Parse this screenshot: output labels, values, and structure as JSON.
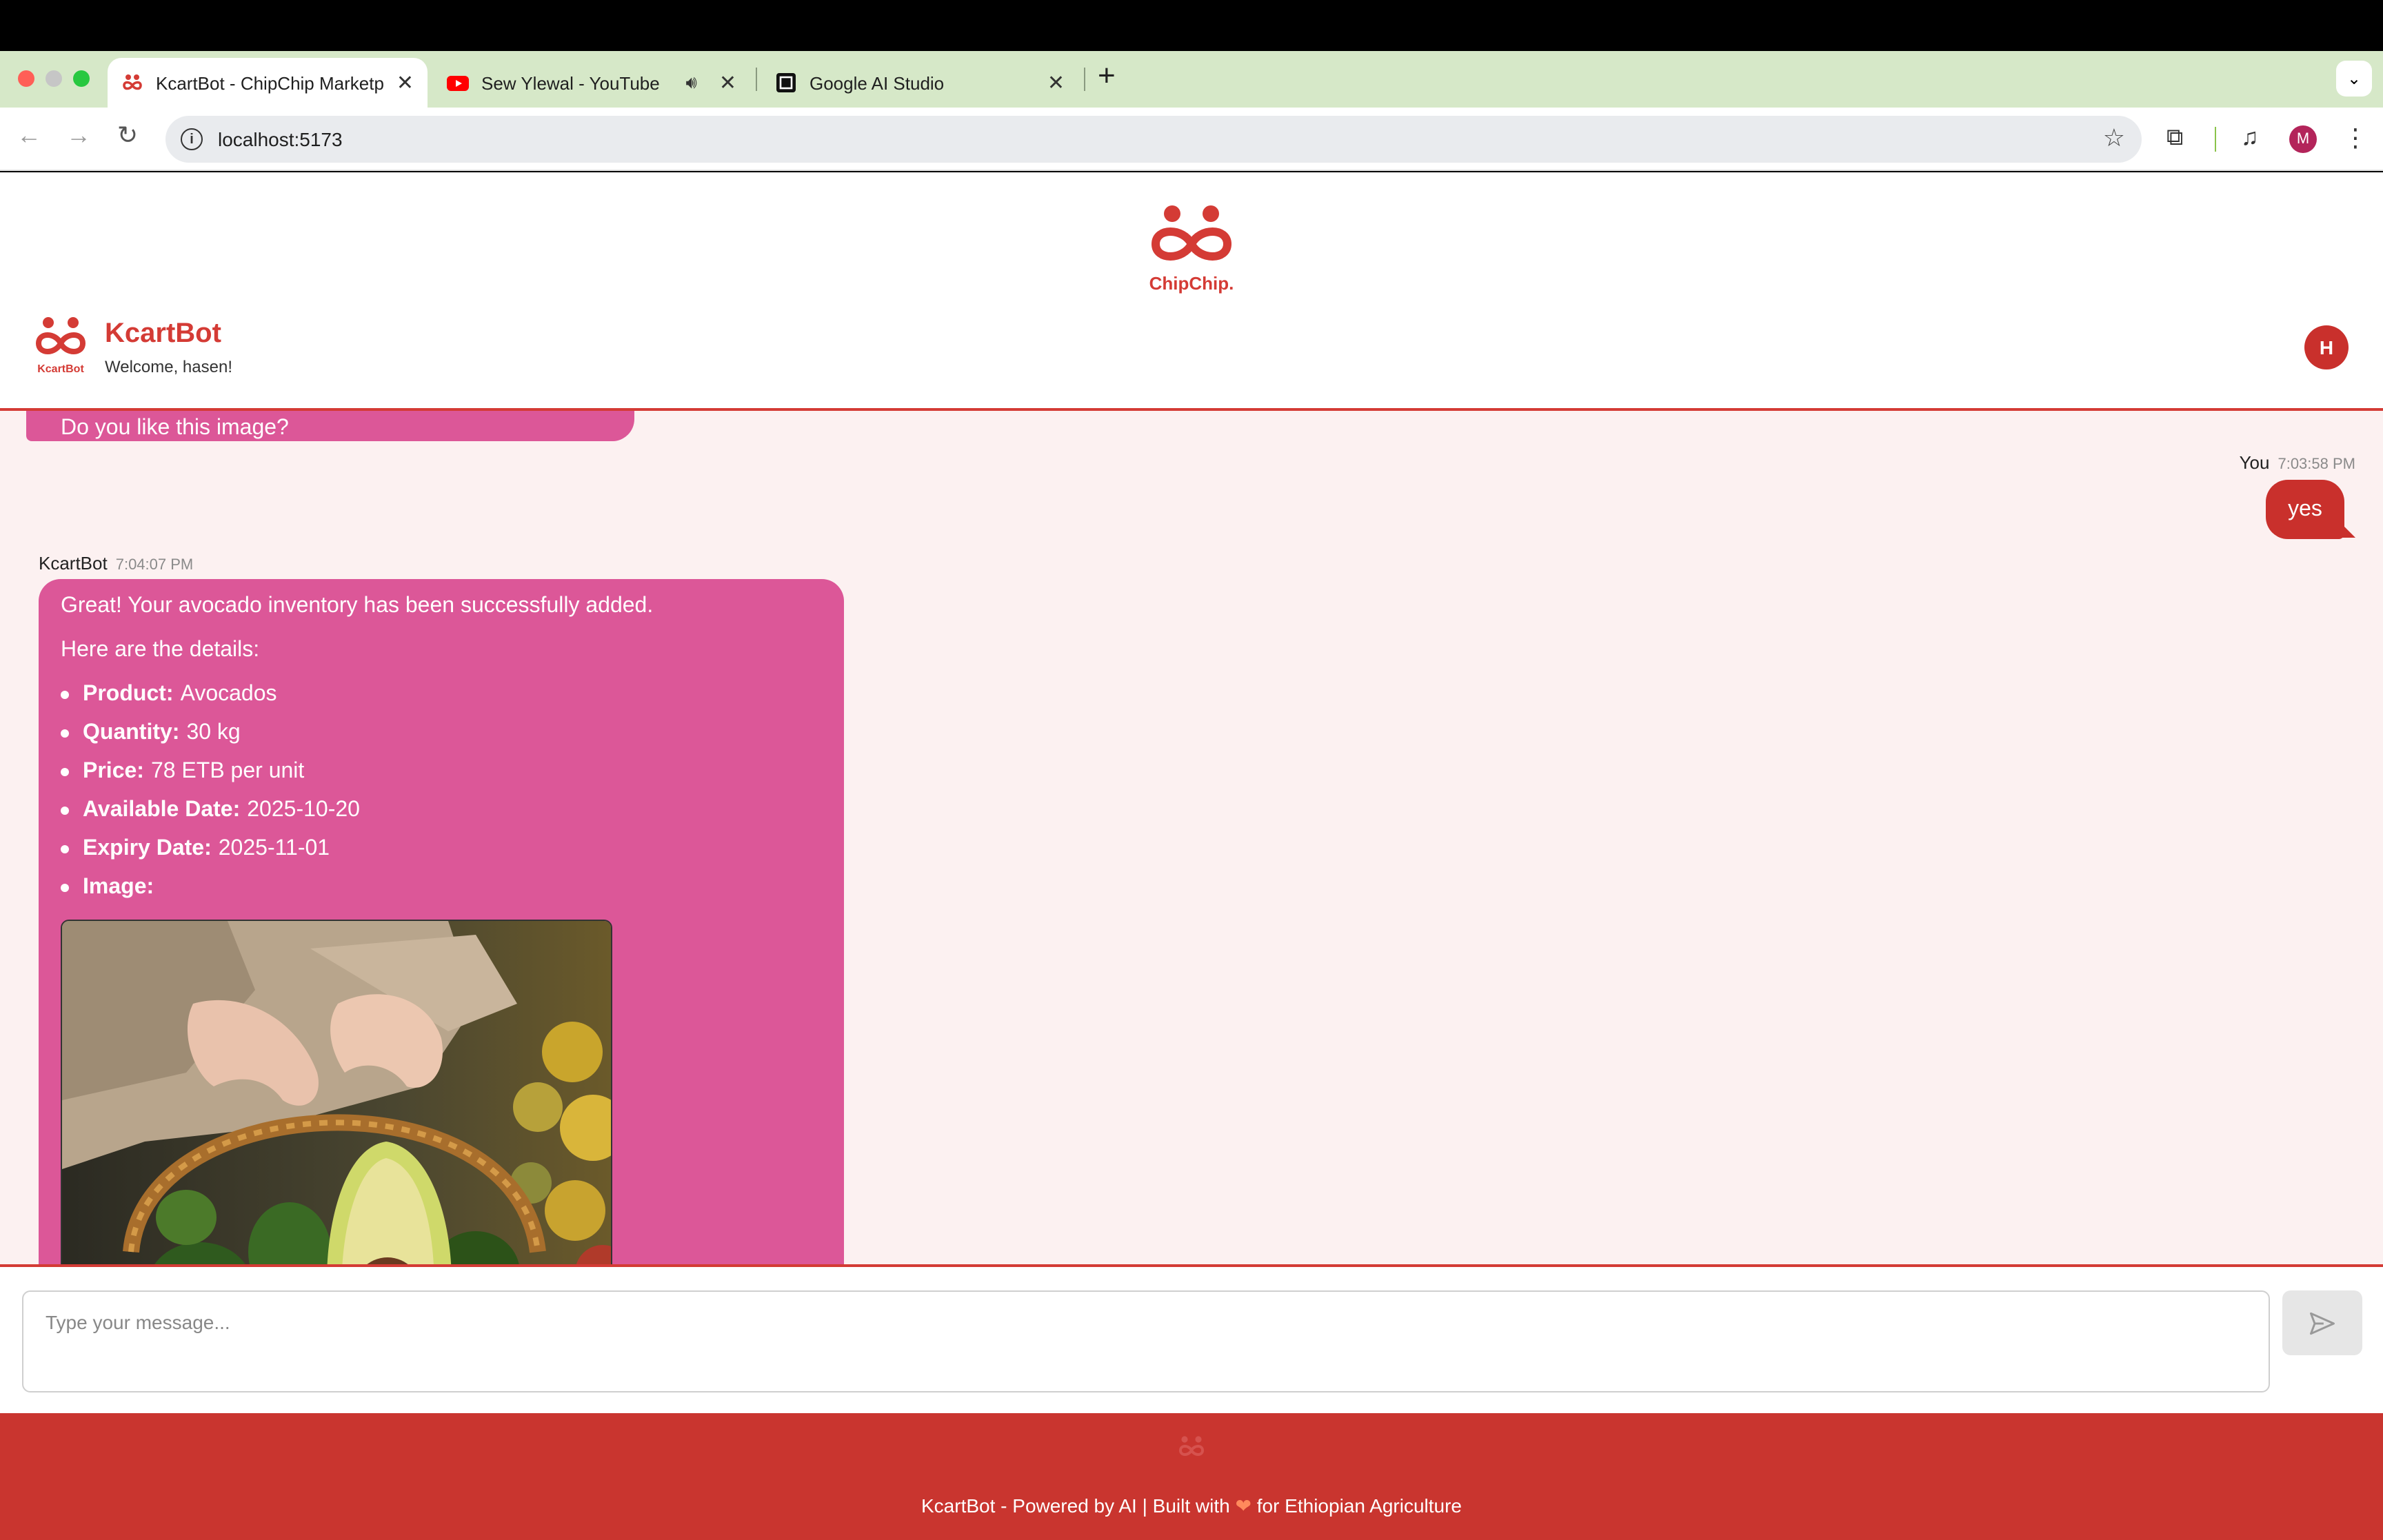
{
  "browser": {
    "tabs": [
      {
        "title": "KcartBot - ChipChip Marketplace",
        "active": true
      },
      {
        "title": "Sew Ylewal - YouTube",
        "active": false,
        "audio": true
      },
      {
        "title": "Google AI Studio",
        "active": false
      }
    ],
    "url": "localhost:5173",
    "profile_initial": "M"
  },
  "brand": {
    "name": "ChipChip.",
    "bot_logo_text": "KcartBot"
  },
  "header": {
    "title": "KcartBot",
    "welcome": "Welcome, hasen!",
    "avatar_initial": "H"
  },
  "chat": {
    "previous_bot_text": "Do you like this image?",
    "user_message": {
      "sender": "You",
      "time": "7:03:58 PM",
      "text": "yes"
    },
    "bot_message": {
      "sender": "KcartBot",
      "time": "7:04:07 PM",
      "intro": "Great! Your avocado inventory has been successfully added.",
      "details_heading": "Here are the details:",
      "details": [
        {
          "label": "Product:",
          "value": "Avocados"
        },
        {
          "label": "Quantity:",
          "value": "30 kg"
        },
        {
          "label": "Price:",
          "value": "78 ETB per unit"
        },
        {
          "label": "Available Date:",
          "value": "2025-10-20"
        },
        {
          "label": "Expiry Date:",
          "value": "2025-11-01"
        },
        {
          "label": "Image:",
          "value": ""
        }
      ]
    }
  },
  "composer": {
    "placeholder": "Type your message..."
  },
  "footer": {
    "text_before": "KcartBot - Powered by AI | Built with",
    "text_after": "for Ethiopian Agriculture"
  },
  "colors": {
    "brand_red": "#d43b35",
    "bot_bubble": "#dc5798",
    "user_bubble": "#c9302c",
    "chat_bg": "#fcf1f1",
    "footer_bg": "#c9352f"
  }
}
